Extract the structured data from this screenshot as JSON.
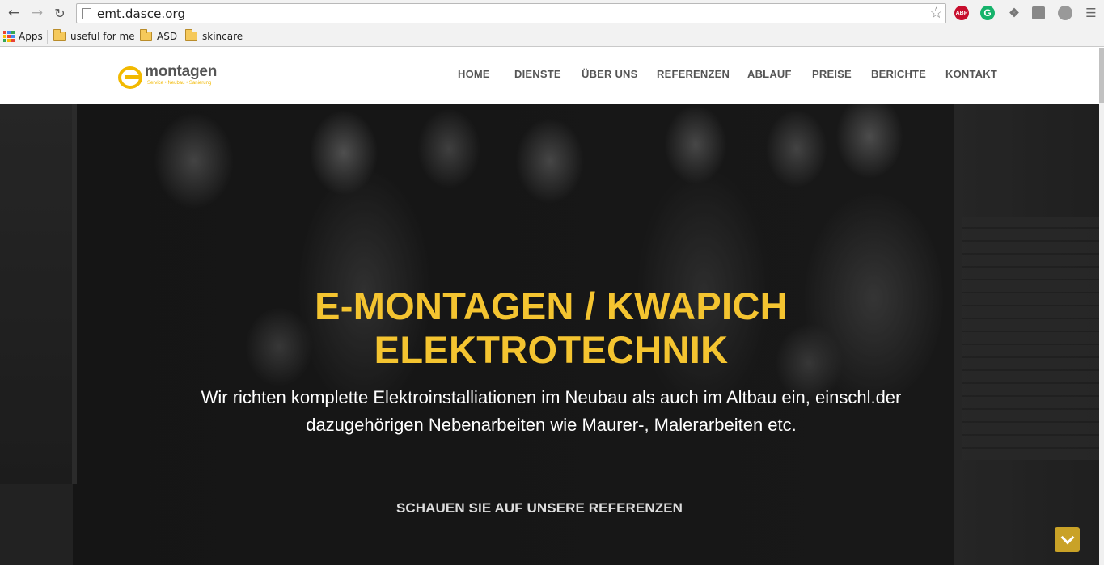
{
  "browser": {
    "url": "emt.dasce.org",
    "extensions": {
      "abp_label": "ABP",
      "grammarly_label": "G"
    },
    "bookmarks": {
      "apps_label": "Apps",
      "items": [
        "useful for me",
        "ASD",
        "skincare"
      ]
    }
  },
  "site": {
    "logo": {
      "word": "montagen",
      "tagline": "Service • Neubau • Sanierung"
    },
    "nav": [
      "HOME",
      "DIENSTE",
      "ÜBER UNS",
      "REFERENZEN",
      "ABLAUF",
      "PREISE",
      "BERICHTE",
      "KONTAKT"
    ]
  },
  "hero": {
    "title_line1": "E-MONTAGEN / KWAPICH",
    "title_line2": "ELEKTROTECHNIK",
    "subtitle_line1": "Wir richten komplette Elektroinstalliationen im Neubau als auch im Altbau ein, einschl.der",
    "subtitle_line2": "dazugehörigen Nebenarbeiten wie Maurer-, Malerarbeiten etc.",
    "cta": "SCHAUEN SIE AUF UNSERE REFERENZEN"
  },
  "colors": {
    "accent": "#f4c430",
    "nav_text": "#555555",
    "scroll_button": "#c9a227"
  }
}
